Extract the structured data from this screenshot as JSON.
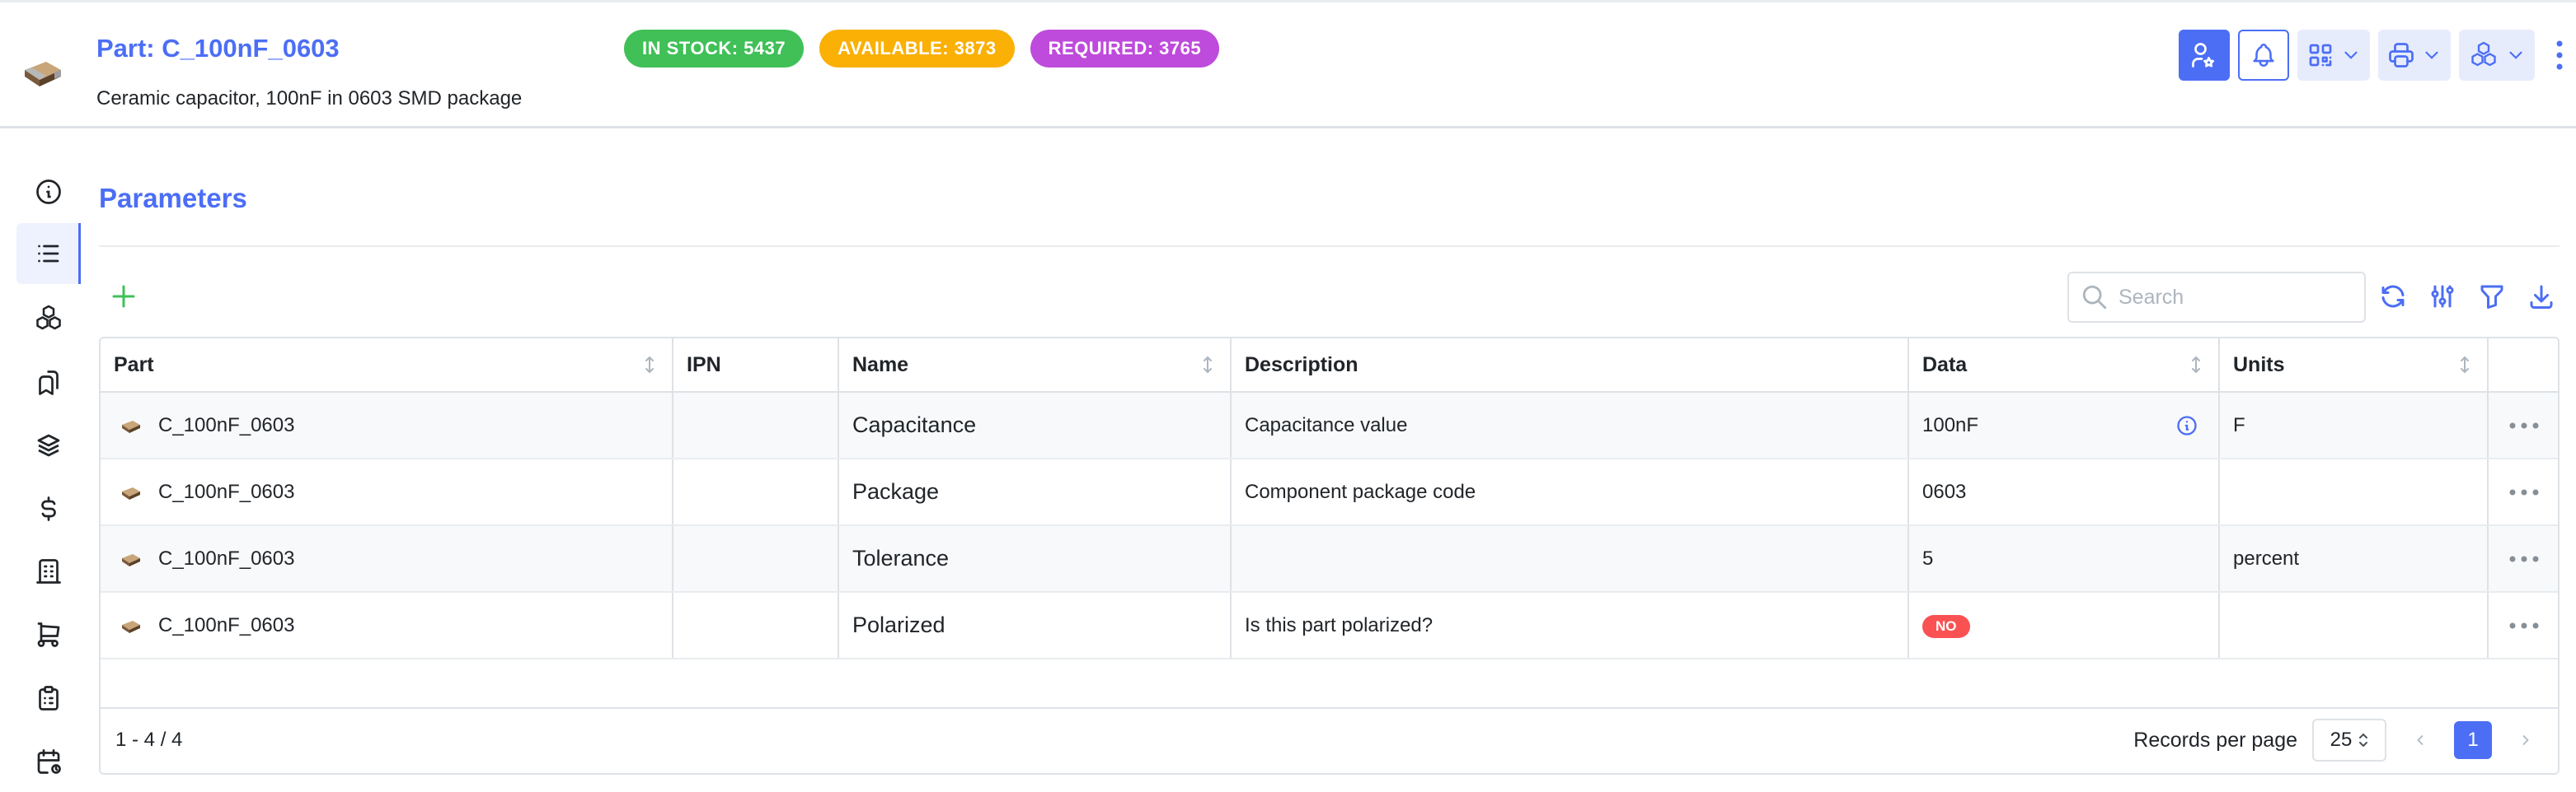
{
  "header": {
    "title": "Part: C_100nF_0603",
    "description": "Ceramic capacitor, 100nF in 0603 SMD package",
    "badges": {
      "in_stock": "IN STOCK: 5437",
      "available": "AVAILABLE: 3873",
      "required": "REQUIRED: 3765"
    },
    "colors": {
      "accent": "#4c6ef5",
      "in_stock": "#40c057",
      "available": "#fab005",
      "required": "#be4bdb"
    }
  },
  "sidebar": {
    "items": [
      {
        "icon": "info-icon",
        "active": false
      },
      {
        "icon": "list-icon",
        "active": true
      },
      {
        "icon": "boxes-icon",
        "active": false
      },
      {
        "icon": "bookmarks-icon",
        "active": false
      },
      {
        "icon": "layers-icon",
        "active": false
      },
      {
        "icon": "dollar-icon",
        "active": false
      },
      {
        "icon": "building-icon",
        "active": false
      },
      {
        "icon": "cart-icon",
        "active": false
      },
      {
        "icon": "clipboard-icon",
        "active": false
      },
      {
        "icon": "calendar-icon",
        "active": false
      }
    ]
  },
  "section": {
    "title": "Parameters"
  },
  "search": {
    "placeholder": "Search"
  },
  "table": {
    "columns": [
      "Part",
      "IPN",
      "Name",
      "Description",
      "Data",
      "Units"
    ],
    "rows": [
      {
        "part": "C_100nF_0603",
        "ipn": "",
        "name": "Capacitance",
        "description": "Capacitance value",
        "data": "100nF",
        "units": "F"
      },
      {
        "part": "C_100nF_0603",
        "ipn": "",
        "name": "Package",
        "description": "Component package code",
        "data": "0603",
        "units": ""
      },
      {
        "part": "C_100nF_0603",
        "ipn": "",
        "name": "Tolerance",
        "description": "",
        "data": "5",
        "units": "percent"
      },
      {
        "part": "C_100nF_0603",
        "ipn": "",
        "name": "Polarized",
        "description": "Is this part polarized?",
        "data": "NO",
        "units": ""
      }
    ]
  },
  "pagination": {
    "range": "1 - 4 / 4",
    "records_label": "Records per page",
    "records_value": "25",
    "current_page": "1"
  }
}
